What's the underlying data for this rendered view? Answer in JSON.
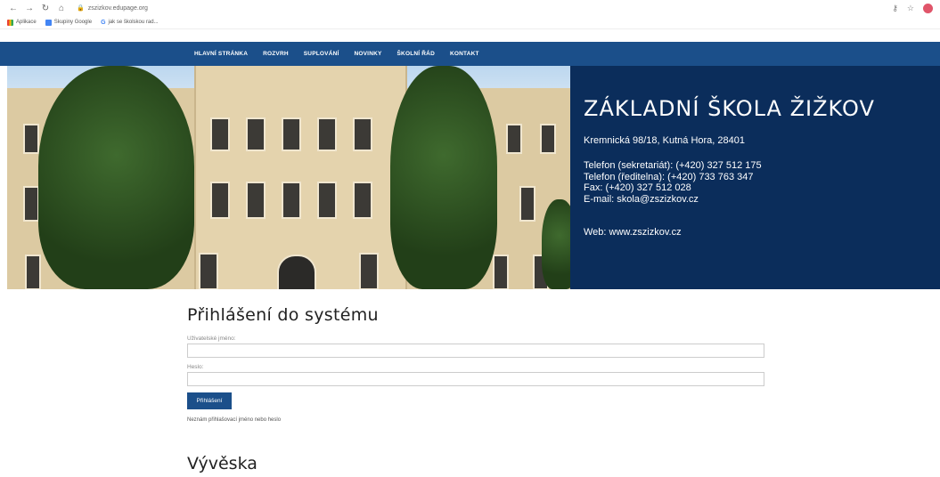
{
  "browser": {
    "url": "zszizkov.edupage.org",
    "bookmarks": [
      {
        "label": "Aplikace"
      },
      {
        "label": "Skupiny Google"
      },
      {
        "label": "jak se školskou rad..."
      }
    ]
  },
  "nav": {
    "items": [
      "HLAVNÍ STRÁNKA",
      "ROZVRH",
      "SUPLOVÁNÍ",
      "NOVINKY",
      "ŠKOLNÍ ŘÁD",
      "KONTAKT"
    ]
  },
  "school": {
    "name": "ZÁKLADNÍ ŠKOLA ŽIŽKOV",
    "address": "Kremnická 98/18, Kutná Hora, 28401",
    "phone_secretary": "Telefon (sekretariát): (+420) 327 512 175",
    "phone_director": "Telefon (ředitelna): (+420) 733 763 347",
    "fax": "Fax: (+420) 327 512 028",
    "email": "E-mail: skola@zszizkov.cz",
    "web": "Web: www.zszizkov.cz"
  },
  "login": {
    "title": "Přihlášení do systému",
    "username_label": "Uživatelské jméno:",
    "password_label": "Heslo:",
    "button": "Přihlášení",
    "forgot": "Neznám přihlašovací jméno nebo heslo"
  },
  "board": {
    "title": "Vývěska"
  },
  "colors": {
    "nav_bg": "#1b4f8a",
    "panel_bg": "#0b2d5b",
    "button_bg": "#1b4f8a"
  }
}
